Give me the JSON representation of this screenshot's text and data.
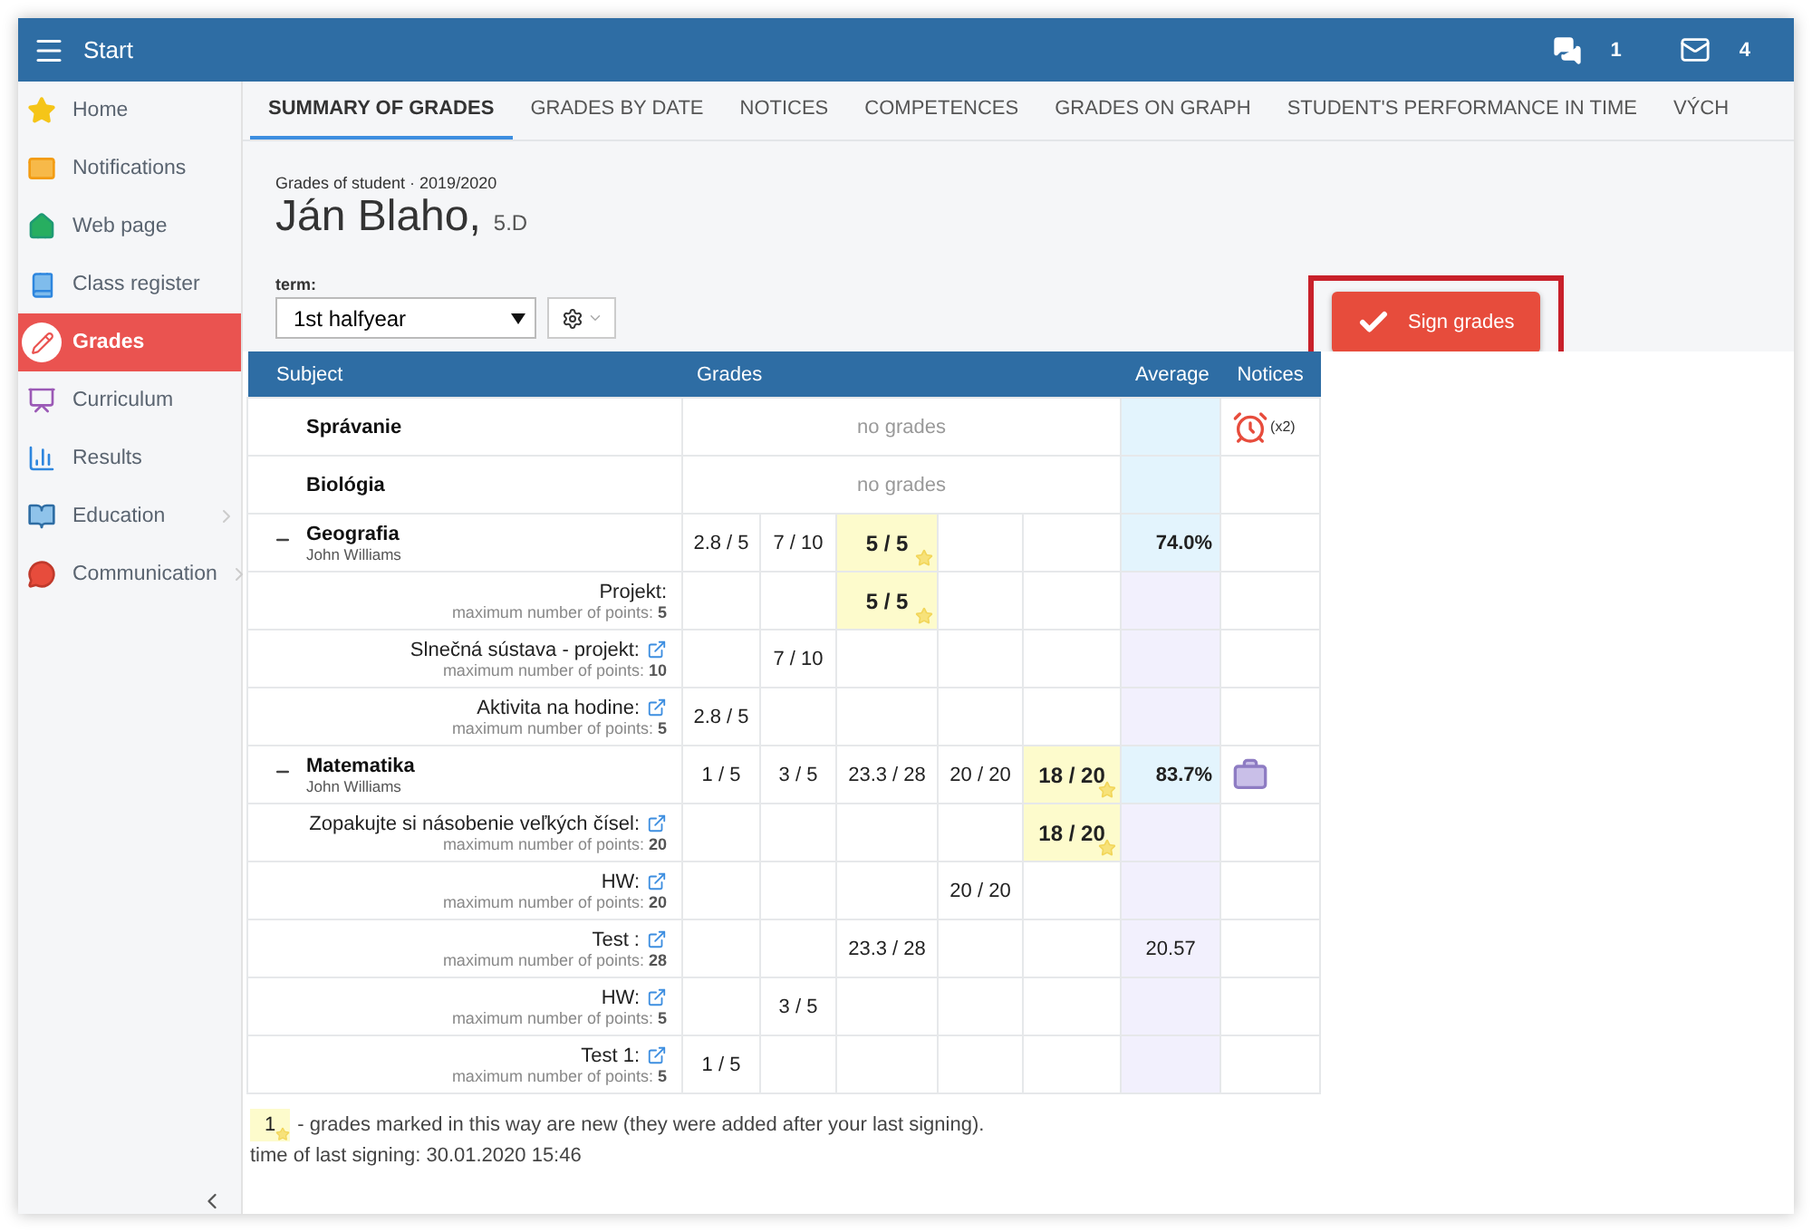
{
  "header": {
    "title": "Start",
    "chat_count": "1",
    "mail_count": "4"
  },
  "sidebar": {
    "items": [
      {
        "label": "Home",
        "selected": false
      },
      {
        "label": "Notifications",
        "selected": false
      },
      {
        "label": "Web page",
        "selected": false
      },
      {
        "label": "Class register",
        "selected": false
      },
      {
        "label": "Grades",
        "selected": true
      },
      {
        "label": "Curriculum",
        "selected": false
      },
      {
        "label": "Results",
        "selected": false
      },
      {
        "label": "Education",
        "selected": false,
        "submenu": true
      },
      {
        "label": "Communication",
        "selected": false,
        "submenu": true
      }
    ]
  },
  "tabs": [
    {
      "label": "SUMMARY OF GRADES",
      "selected": true
    },
    {
      "label": "GRADES BY DATE",
      "selected": false
    },
    {
      "label": "NOTICES",
      "selected": false
    },
    {
      "label": "COMPETENCES",
      "selected": false
    },
    {
      "label": "GRADES ON GRAPH",
      "selected": false
    },
    {
      "label": "STUDENT'S PERFORMANCE IN TIME",
      "selected": false
    },
    {
      "label": "VÝCH",
      "selected": false
    }
  ],
  "student": {
    "caption": "Grades of student · 2019/2020",
    "name": "Ján Blaho,",
    "class": "5.D"
  },
  "term": {
    "label": "term:",
    "value": "1st halfyear"
  },
  "sign_button": "Sign grades",
  "table": {
    "columns": [
      "Subject",
      "Grades",
      "Average",
      "Notices"
    ],
    "rows": [
      {
        "kind": "subject",
        "name": "Správanie",
        "note": "no grades",
        "notice": {
          "kind": "alarm",
          "count": "(x2)"
        }
      },
      {
        "kind": "subject",
        "name": "Biológia",
        "note": "no grades"
      },
      {
        "kind": "subject",
        "name": "Geografia",
        "teacher": "John Williams",
        "expanded": true,
        "grades": [
          {
            "kind": "grade",
            "value": "2.8 / 5",
            "new": false
          },
          {
            "kind": "grade",
            "value": "7 / 10",
            "new": false
          },
          {
            "kind": "grade",
            "value": "5 / 5",
            "new": true
          },
          {
            "kind": "empty"
          },
          {
            "kind": "empty"
          }
        ],
        "average": "74.0%"
      },
      {
        "kind": "item",
        "name": "Projekt:",
        "max": "maximum number of points: **5**",
        "link": false,
        "grades": [
          {
            "kind": "empty"
          },
          {
            "kind": "empty"
          },
          {
            "kind": "grade",
            "value": "5 / 5",
            "new": true
          },
          {
            "kind": "empty"
          },
          {
            "kind": "empty"
          }
        ]
      },
      {
        "kind": "item",
        "name": "Slnečná sústava - projekt:",
        "max": "maximum number of points: **10**",
        "link": true,
        "grades": [
          {
            "kind": "empty"
          },
          {
            "kind": "grade",
            "value": "7 / 10",
            "new": false
          },
          {
            "kind": "empty"
          },
          {
            "kind": "empty"
          },
          {
            "kind": "empty"
          }
        ]
      },
      {
        "kind": "item",
        "name": "Aktivita na hodine:",
        "max": "maximum number of points: **5**",
        "link": true,
        "grades": [
          {
            "kind": "grade",
            "value": "2.8 / 5",
            "new": false
          },
          {
            "kind": "empty"
          },
          {
            "kind": "empty"
          },
          {
            "kind": "empty"
          },
          {
            "kind": "empty"
          }
        ]
      },
      {
        "kind": "subject",
        "name": "Matematika",
        "teacher": "John Williams",
        "expanded": true,
        "grades": [
          {
            "kind": "grade",
            "value": "1 / 5",
            "new": false
          },
          {
            "kind": "grade",
            "value": "3 / 5",
            "new": false
          },
          {
            "kind": "grade",
            "value": "23.3 / 28",
            "new": false
          },
          {
            "kind": "grade",
            "value": "20 / 20",
            "new": false
          },
          {
            "kind": "grade",
            "value": "18 / 20",
            "new": true
          }
        ],
        "average": "83.7%",
        "notice": {
          "kind": "bag"
        }
      },
      {
        "kind": "item",
        "name": "Zopakujte si násobenie veľkých čísel:",
        "max": "maximum number of points: **20**",
        "link": true,
        "grades": [
          {
            "kind": "empty"
          },
          {
            "kind": "empty"
          },
          {
            "kind": "empty"
          },
          {
            "kind": "empty"
          },
          {
            "kind": "grade",
            "value": "18 / 20",
            "new": true
          }
        ]
      },
      {
        "kind": "item",
        "name": "HW:",
        "max": "maximum number of points: **20**",
        "link": true,
        "grades": [
          {
            "kind": "empty"
          },
          {
            "kind": "empty"
          },
          {
            "kind": "empty"
          },
          {
            "kind": "grade",
            "value": "20 / 20",
            "new": false
          },
          {
            "kind": "empty"
          }
        ]
      },
      {
        "kind": "item",
        "name": "Test :",
        "max": "maximum number of points: **28**",
        "link": true,
        "grades": [
          {
            "kind": "empty"
          },
          {
            "kind": "empty"
          },
          {
            "kind": "grade",
            "value": "23.3 / 28",
            "new": false
          },
          {
            "kind": "empty"
          },
          {
            "kind": "empty"
          }
        ],
        "average": "20.57"
      },
      {
        "kind": "item",
        "name": "HW:",
        "max": "maximum number of points: **5**",
        "link": true,
        "grades": [
          {
            "kind": "empty"
          },
          {
            "kind": "grade",
            "value": "3 / 5",
            "new": false
          },
          {
            "kind": "empty"
          },
          {
            "kind": "empty"
          },
          {
            "kind": "empty"
          }
        ]
      },
      {
        "kind": "item",
        "name": "Test 1:",
        "max": "maximum number of points: **5**",
        "link": true,
        "grades": [
          {
            "kind": "grade",
            "value": "1 / 5",
            "new": false
          },
          {
            "kind": "empty"
          },
          {
            "kind": "empty"
          },
          {
            "kind": "empty"
          },
          {
            "kind": "empty"
          }
        ]
      }
    ]
  },
  "legend": {
    "sample": "1",
    "text": "- grades marked in this way are new (they were added after your last signing)."
  },
  "last_signing": "time of last signing: 30.01.2020 15:46"
}
